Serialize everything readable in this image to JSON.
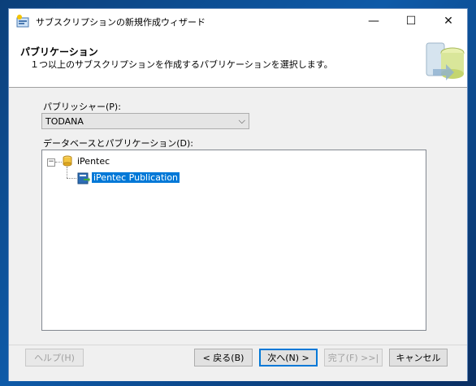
{
  "window": {
    "title": "サブスクリプションの新規作成ウィザード",
    "controls": {
      "minimize": "—",
      "maximize": "☐",
      "close": "✕"
    }
  },
  "header": {
    "title": "パブリケーション",
    "subtitle": "１つ以上のサブスクリプションを作成するパブリケーションを選択します。"
  },
  "publisher": {
    "label": "パブリッシャー(P):",
    "value": "TODANA"
  },
  "tree": {
    "label": "データベースとパブリケーション(D):",
    "database": "iPentec",
    "publication": "iPentec Publication"
  },
  "buttons": {
    "help": "ヘルプ(H)",
    "back": "< 戻る(B)",
    "next": "次へ(N) >",
    "finish": "完了(F) >>|",
    "cancel": "キャンセル"
  }
}
